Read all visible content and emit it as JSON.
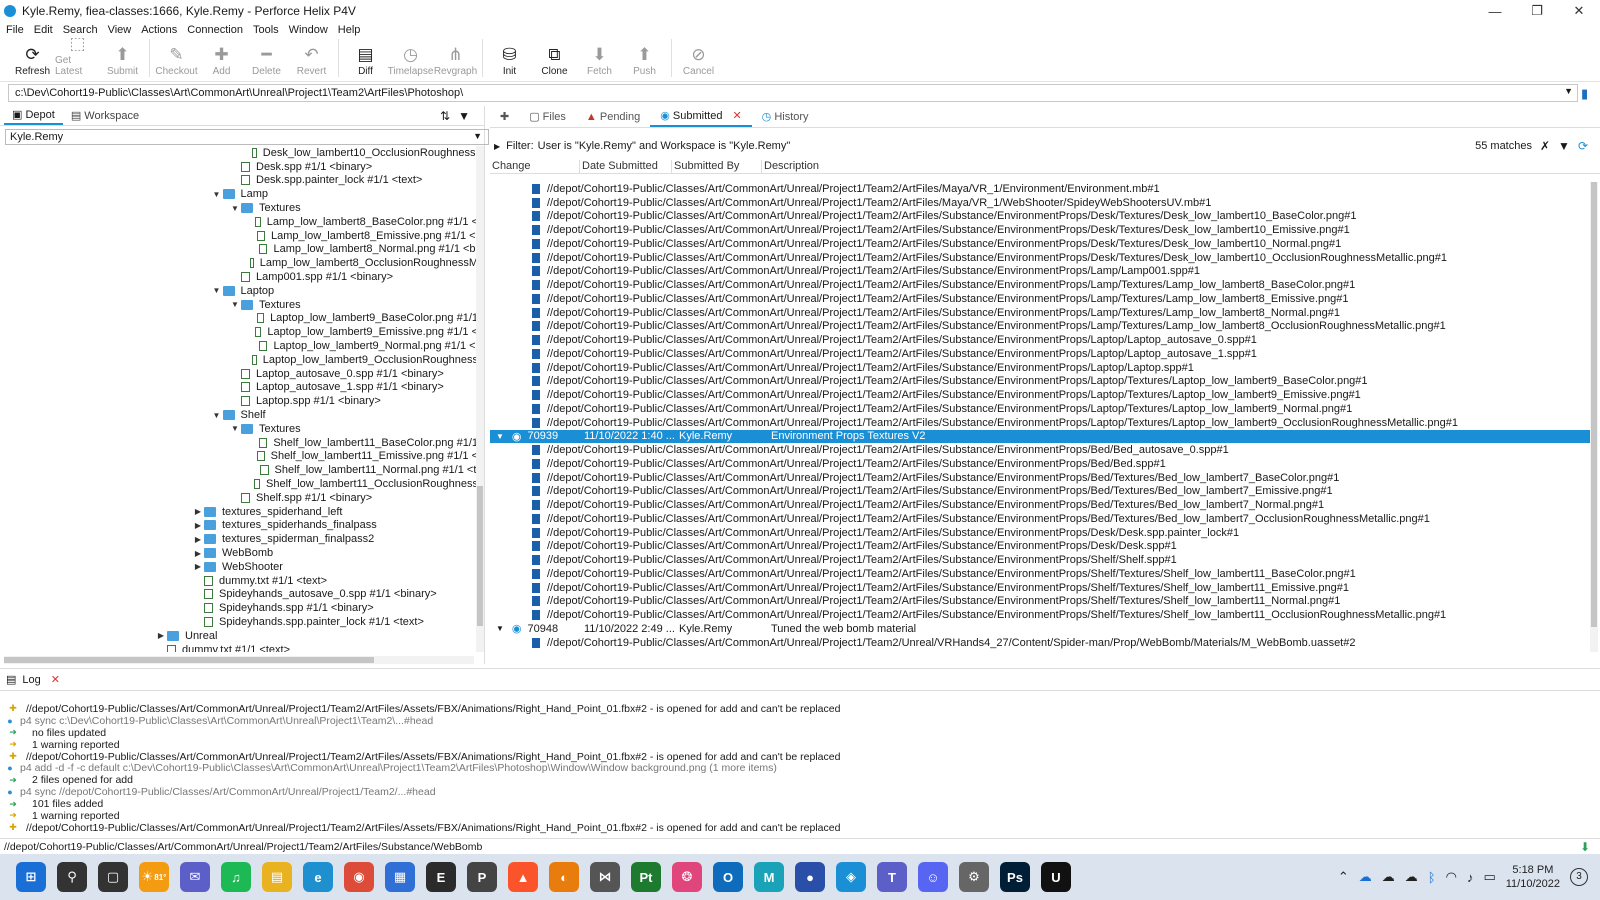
{
  "window": {
    "title": "Kyle.Remy,  fiea-classes:1666,  Kyle.Remy - Perforce Helix P4V"
  },
  "menu": [
    "File",
    "Edit",
    "Search",
    "View",
    "Actions",
    "Connection",
    "Tools",
    "Window",
    "Help"
  ],
  "toolbar": {
    "buttons": [
      {
        "label": "Refresh",
        "icon": "refresh-icon",
        "enabled": true
      },
      {
        "label": "Get Latest",
        "icon": "get-latest-icon",
        "enabled": false
      },
      {
        "label": "Submit",
        "icon": "submit-icon",
        "enabled": false
      },
      {
        "label": "Checkout",
        "icon": "checkout-icon",
        "enabled": false
      },
      {
        "label": "Add",
        "icon": "add-icon",
        "enabled": false
      },
      {
        "label": "Delete",
        "icon": "delete-icon",
        "enabled": false
      },
      {
        "label": "Revert",
        "icon": "revert-icon",
        "enabled": false
      },
      {
        "label": "Diff",
        "icon": "diff-icon",
        "enabled": true
      },
      {
        "label": "Timelapse",
        "icon": "timelapse-icon",
        "enabled": false
      },
      {
        "label": "Revgraph",
        "icon": "revgraph-icon",
        "enabled": false
      },
      {
        "label": "Init",
        "icon": "init-icon",
        "enabled": true
      },
      {
        "label": "Clone",
        "icon": "clone-icon",
        "enabled": true
      },
      {
        "label": "Fetch",
        "icon": "fetch-icon",
        "enabled": false
      },
      {
        "label": "Push",
        "icon": "push-icon",
        "enabled": false
      },
      {
        "label": "Cancel",
        "icon": "cancel-icon",
        "enabled": false
      }
    ]
  },
  "path_bar": {
    "value": "c:\\Dev\\Cohort19-Public\\Classes\\Art\\CommonArt\\Unreal\\Project1\\Team2\\ArtFiles\\Photoshop\\"
  },
  "left_pane": {
    "tabs": [
      "Depot",
      "Workspace"
    ],
    "workspace": "Kyle.Remy",
    "tree": [
      {
        "indent": 5,
        "twisty": "",
        "type": "file",
        "label": "Desk_low_lambert10_OcclusionRoughnessl"
      },
      {
        "indent": 4,
        "twisty": "",
        "type": "file",
        "label": "Desk.spp #1/1 <binary>"
      },
      {
        "indent": 4,
        "twisty": "",
        "type": "file",
        "label": "Desk.spp.painter_lock #1/1 <text>"
      },
      {
        "indent": 3,
        "twisty": "▼",
        "type": "folder",
        "label": "Lamp"
      },
      {
        "indent": 4,
        "twisty": "▼",
        "type": "folder",
        "label": "Textures"
      },
      {
        "indent": 5,
        "twisty": "",
        "type": "file",
        "label": "Lamp_low_lambert8_BaseColor.png #1/1 <"
      },
      {
        "indent": 5,
        "twisty": "",
        "type": "file",
        "label": "Lamp_low_lambert8_Emissive.png #1/1 <l"
      },
      {
        "indent": 5,
        "twisty": "",
        "type": "file",
        "label": "Lamp_low_lambert8_Normal.png #1/1 <bi"
      },
      {
        "indent": 5,
        "twisty": "",
        "type": "file",
        "label": "Lamp_low_lambert8_OcclusionRoughnessM"
      },
      {
        "indent": 4,
        "twisty": "",
        "type": "file",
        "label": "Lamp001.spp #1/1 <binary>"
      },
      {
        "indent": 3,
        "twisty": "▼",
        "type": "folder",
        "label": "Laptop"
      },
      {
        "indent": 4,
        "twisty": "▼",
        "type": "folder",
        "label": "Textures"
      },
      {
        "indent": 5,
        "twisty": "",
        "type": "file",
        "label": "Laptop_low_lambert9_BaseColor.png #1/1"
      },
      {
        "indent": 5,
        "twisty": "",
        "type": "file",
        "label": "Laptop_low_lambert9_Emissive.png #1/1 <"
      },
      {
        "indent": 5,
        "twisty": "",
        "type": "file",
        "label": "Laptop_low_lambert9_Normal.png #1/1 <l"
      },
      {
        "indent": 5,
        "twisty": "",
        "type": "file",
        "label": "Laptop_low_lambert9_OcclusionRoughness"
      },
      {
        "indent": 4,
        "twisty": "",
        "type": "file",
        "label": "Laptop_autosave_0.spp #1/1 <binary>"
      },
      {
        "indent": 4,
        "twisty": "",
        "type": "file",
        "label": "Laptop_autosave_1.spp #1/1 <binary>"
      },
      {
        "indent": 4,
        "twisty": "",
        "type": "file",
        "label": "Laptop.spp #1/1 <binary>"
      },
      {
        "indent": 3,
        "twisty": "▼",
        "type": "folder",
        "label": "Shelf"
      },
      {
        "indent": 4,
        "twisty": "▼",
        "type": "folder",
        "label": "Textures"
      },
      {
        "indent": 5,
        "twisty": "",
        "type": "file",
        "label": "Shelf_low_lambert11_BaseColor.png #1/1"
      },
      {
        "indent": 5,
        "twisty": "",
        "type": "file",
        "label": "Shelf_low_lambert11_Emissive.png #1/1 <"
      },
      {
        "indent": 5,
        "twisty": "",
        "type": "file",
        "label": "Shelf_low_lambert11_Normal.png #1/1 <t"
      },
      {
        "indent": 5,
        "twisty": "",
        "type": "file",
        "label": "Shelf_low_lambert11_OcclusionRoughness"
      },
      {
        "indent": 4,
        "twisty": "",
        "type": "file",
        "label": "Shelf.spp #1/1 <binary>"
      },
      {
        "indent": 2,
        "twisty": "▶",
        "type": "folder",
        "label": "textures_spiderhand_left"
      },
      {
        "indent": 2,
        "twisty": "▶",
        "type": "folder",
        "label": "textures_spiderhands_finalpass"
      },
      {
        "indent": 2,
        "twisty": "▶",
        "type": "folder",
        "label": "textures_spiderman_finalpass2"
      },
      {
        "indent": 2,
        "twisty": "▶",
        "type": "folder",
        "label": "WebBomb"
      },
      {
        "indent": 2,
        "twisty": "▶",
        "type": "folder",
        "label": "WebShooter"
      },
      {
        "indent": 2,
        "twisty": "",
        "type": "file",
        "label": "dummy.txt #1/1 <text>"
      },
      {
        "indent": 2,
        "twisty": "",
        "type": "file",
        "label": "Spideyhands_autosave_0.spp #1/1 <binary>"
      },
      {
        "indent": 2,
        "twisty": "",
        "type": "file",
        "label": "Spideyhands.spp #1/1 <binary>"
      },
      {
        "indent": 2,
        "twisty": "",
        "type": "file",
        "label": "Spideyhands.spp.painter_lock #1/1 <text>"
      },
      {
        "indent": 0,
        "twisty": "▶",
        "type": "folder",
        "label": "Unreal"
      },
      {
        "indent": 0,
        "twisty": "",
        "type": "file",
        "label": "dummy.txt #1/1 <text>"
      }
    ]
  },
  "right_pane": {
    "tabs": [
      "Files",
      "Pending",
      "Submitted",
      "History"
    ],
    "active_tab": "Submitted",
    "filter_label": "Filter:",
    "filter_text": "User is \"Kyle.Remy\" and Workspace is \"Kyle.Remy\"",
    "matches": "55 matches",
    "columns": [
      "Change",
      "Date Submitted",
      "Submitted By",
      "Description"
    ],
    "rows": [
      {
        "kind": "file",
        "text": "//depot/Cohort19-Public/Classes/Art/CommonArt/Unreal/Project1/Team2/ArtFiles/Maya/VR_1/Environment/Environment.mb#1"
      },
      {
        "kind": "file",
        "text": "//depot/Cohort19-Public/Classes/Art/CommonArt/Unreal/Project1/Team2/ArtFiles/Maya/VR_1/WebShooter/SpideyWebShootersUV.mb#1"
      },
      {
        "kind": "file",
        "text": "//depot/Cohort19-Public/Classes/Art/CommonArt/Unreal/Project1/Team2/ArtFiles/Substance/EnvironmentProps/Desk/Textures/Desk_low_lambert10_BaseColor.png#1"
      },
      {
        "kind": "file",
        "text": "//depot/Cohort19-Public/Classes/Art/CommonArt/Unreal/Project1/Team2/ArtFiles/Substance/EnvironmentProps/Desk/Textures/Desk_low_lambert10_Emissive.png#1"
      },
      {
        "kind": "file",
        "text": "//depot/Cohort19-Public/Classes/Art/CommonArt/Unreal/Project1/Team2/ArtFiles/Substance/EnvironmentProps/Desk/Textures/Desk_low_lambert10_Normal.png#1"
      },
      {
        "kind": "file",
        "text": "//depot/Cohort19-Public/Classes/Art/CommonArt/Unreal/Project1/Team2/ArtFiles/Substance/EnvironmentProps/Desk/Textures/Desk_low_lambert10_OcclusionRoughnessMetallic.png#1"
      },
      {
        "kind": "file",
        "text": "//depot/Cohort19-Public/Classes/Art/CommonArt/Unreal/Project1/Team2/ArtFiles/Substance/EnvironmentProps/Lamp/Lamp001.spp#1"
      },
      {
        "kind": "file",
        "text": "//depot/Cohort19-Public/Classes/Art/CommonArt/Unreal/Project1/Team2/ArtFiles/Substance/EnvironmentProps/Lamp/Textures/Lamp_low_lambert8_BaseColor.png#1"
      },
      {
        "kind": "file",
        "text": "//depot/Cohort19-Public/Classes/Art/CommonArt/Unreal/Project1/Team2/ArtFiles/Substance/EnvironmentProps/Lamp/Textures/Lamp_low_lambert8_Emissive.png#1"
      },
      {
        "kind": "file",
        "text": "//depot/Cohort19-Public/Classes/Art/CommonArt/Unreal/Project1/Team2/ArtFiles/Substance/EnvironmentProps/Lamp/Textures/Lamp_low_lambert8_Normal.png#1"
      },
      {
        "kind": "file",
        "text": "//depot/Cohort19-Public/Classes/Art/CommonArt/Unreal/Project1/Team2/ArtFiles/Substance/EnvironmentProps/Lamp/Textures/Lamp_low_lambert8_OcclusionRoughnessMetallic.png#1"
      },
      {
        "kind": "file",
        "text": "//depot/Cohort19-Public/Classes/Art/CommonArt/Unreal/Project1/Team2/ArtFiles/Substance/EnvironmentProps/Laptop/Laptop_autosave_0.spp#1"
      },
      {
        "kind": "file",
        "text": "//depot/Cohort19-Public/Classes/Art/CommonArt/Unreal/Project1/Team2/ArtFiles/Substance/EnvironmentProps/Laptop/Laptop_autosave_1.spp#1"
      },
      {
        "kind": "file",
        "text": "//depot/Cohort19-Public/Classes/Art/CommonArt/Unreal/Project1/Team2/ArtFiles/Substance/EnvironmentProps/Laptop/Laptop.spp#1"
      },
      {
        "kind": "file",
        "text": "//depot/Cohort19-Public/Classes/Art/CommonArt/Unreal/Project1/Team2/ArtFiles/Substance/EnvironmentProps/Laptop/Textures/Laptop_low_lambert9_BaseColor.png#1"
      },
      {
        "kind": "file",
        "text": "//depot/Cohort19-Public/Classes/Art/CommonArt/Unreal/Project1/Team2/ArtFiles/Substance/EnvironmentProps/Laptop/Textures/Laptop_low_lambert9_Emissive.png#1"
      },
      {
        "kind": "file",
        "text": "//depot/Cohort19-Public/Classes/Art/CommonArt/Unreal/Project1/Team2/ArtFiles/Substance/EnvironmentProps/Laptop/Textures/Laptop_low_lambert9_Normal.png#1"
      },
      {
        "kind": "file",
        "text": "//depot/Cohort19-Public/Classes/Art/CommonArt/Unreal/Project1/Team2/ArtFiles/Substance/EnvironmentProps/Laptop/Textures/Laptop_low_lambert9_OcclusionRoughnessMetallic.png#1"
      },
      {
        "kind": "change",
        "selected": true,
        "change": "70939",
        "date": "11/10/2022 1:40 ...",
        "by": "Kyle.Remy",
        "desc": "Environment Props Textures V2"
      },
      {
        "kind": "file",
        "text": "//depot/Cohort19-Public/Classes/Art/CommonArt/Unreal/Project1/Team2/ArtFiles/Substance/EnvironmentProps/Bed/Bed_autosave_0.spp#1"
      },
      {
        "kind": "file",
        "text": "//depot/Cohort19-Public/Classes/Art/CommonArt/Unreal/Project1/Team2/ArtFiles/Substance/EnvironmentProps/Bed/Bed.spp#1"
      },
      {
        "kind": "file",
        "text": "//depot/Cohort19-Public/Classes/Art/CommonArt/Unreal/Project1/Team2/ArtFiles/Substance/EnvironmentProps/Bed/Textures/Bed_low_lambert7_BaseColor.png#1"
      },
      {
        "kind": "file",
        "text": "//depot/Cohort19-Public/Classes/Art/CommonArt/Unreal/Project1/Team2/ArtFiles/Substance/EnvironmentProps/Bed/Textures/Bed_low_lambert7_Emissive.png#1"
      },
      {
        "kind": "file",
        "text": "//depot/Cohort19-Public/Classes/Art/CommonArt/Unreal/Project1/Team2/ArtFiles/Substance/EnvironmentProps/Bed/Textures/Bed_low_lambert7_Normal.png#1"
      },
      {
        "kind": "file",
        "text": "//depot/Cohort19-Public/Classes/Art/CommonArt/Unreal/Project1/Team2/ArtFiles/Substance/EnvironmentProps/Bed/Textures/Bed_low_lambert7_OcclusionRoughnessMetallic.png#1"
      },
      {
        "kind": "file",
        "text": "//depot/Cohort19-Public/Classes/Art/CommonArt/Unreal/Project1/Team2/ArtFiles/Substance/EnvironmentProps/Desk/Desk.spp.painter_lock#1"
      },
      {
        "kind": "file",
        "text": "//depot/Cohort19-Public/Classes/Art/CommonArt/Unreal/Project1/Team2/ArtFiles/Substance/EnvironmentProps/Desk/Desk.spp#1"
      },
      {
        "kind": "file",
        "text": "//depot/Cohort19-Public/Classes/Art/CommonArt/Unreal/Project1/Team2/ArtFiles/Substance/EnvironmentProps/Shelf/Shelf.spp#1"
      },
      {
        "kind": "file",
        "text": "//depot/Cohort19-Public/Classes/Art/CommonArt/Unreal/Project1/Team2/ArtFiles/Substance/EnvironmentProps/Shelf/Textures/Shelf_low_lambert11_BaseColor.png#1"
      },
      {
        "kind": "file",
        "text": "//depot/Cohort19-Public/Classes/Art/CommonArt/Unreal/Project1/Team2/ArtFiles/Substance/EnvironmentProps/Shelf/Textures/Shelf_low_lambert11_Emissive.png#1"
      },
      {
        "kind": "file",
        "text": "//depot/Cohort19-Public/Classes/Art/CommonArt/Unreal/Project1/Team2/ArtFiles/Substance/EnvironmentProps/Shelf/Textures/Shelf_low_lambert11_Normal.png#1"
      },
      {
        "kind": "file",
        "text": "//depot/Cohort19-Public/Classes/Art/CommonArt/Unreal/Project1/Team2/ArtFiles/Substance/EnvironmentProps/Shelf/Textures/Shelf_low_lambert11_OcclusionRoughnessMetallic.png#1"
      },
      {
        "kind": "change",
        "selected": false,
        "change": "70948",
        "date": "11/10/2022 2:49 ...",
        "by": "Kyle.Remy",
        "desc": "Tuned the web bomb material"
      },
      {
        "kind": "file",
        "text": "//depot/Cohort19-Public/Classes/Art/CommonArt/Unreal/Project1/Team2/Unreal/VRHands4_27/Content/Spider-man/Prop/WebBomb/Materials/M_WebBomb.uasset#2"
      }
    ]
  },
  "log": {
    "tab": "Log",
    "lines": [
      {
        "kind": "warn",
        "text": "//depot/Cohort19-Public/Classes/Art/CommonArt/Unreal/Project1/Team2/ArtFiles/Assets/FBX/Animations/Right_Hand_Point_01.fbx#2 - is opened for add and can't be replaced"
      },
      {
        "kind": "cmd",
        "text": "p4 sync c:\\Dev\\Cohort19-Public\\Classes\\Art\\CommonArt\\Unreal\\Project1\\Team2\\...#head"
      },
      {
        "kind": "ok",
        "text": "no files updated"
      },
      {
        "kind": "ok2",
        "text": "1 warning reported"
      },
      {
        "kind": "warn",
        "text": "//depot/Cohort19-Public/Classes/Art/CommonArt/Unreal/Project1/Team2/ArtFiles/Assets/FBX/Animations/Right_Hand_Point_01.fbx#2 - is opened for add and can't be replaced"
      },
      {
        "kind": "cmd",
        "text": "p4 add -d -f -c default c:\\Dev\\Cohort19-Public\\Classes\\Art\\CommonArt\\Unreal\\Project1\\Team2\\ArtFiles\\Photoshop\\Window\\Window background.png (1 more items)"
      },
      {
        "kind": "ok",
        "text": "2 files opened for add"
      },
      {
        "kind": "cmd",
        "text": "p4 sync //depot/Cohort19-Public/Classes/Art/CommonArt/Unreal/Project1/Team2/...#head"
      },
      {
        "kind": "ok",
        "text": "101 files added"
      },
      {
        "kind": "ok2",
        "text": "1 warning reported"
      },
      {
        "kind": "warn",
        "text": "//depot/Cohort19-Public/Classes/Art/CommonArt/Unreal/Project1/Team2/ArtFiles/Assets/FBX/Animations/Right_Hand_Point_01.fbx#2 - is opened for add and can't be replaced"
      }
    ]
  },
  "status_bar": {
    "text": "//depot/Cohort19-Public/Classes/Art/CommonArt/Unreal/Project1/Team2/ArtFiles/Substance/WebBomb"
  },
  "taskbar": {
    "weather": "81°",
    "apps": [
      {
        "name": "start-icon",
        "glyph": "⊞",
        "color": "#1a6fd6"
      },
      {
        "name": "search-icon",
        "glyph": "⚲",
        "color": "#333333"
      },
      {
        "name": "task-view-icon",
        "glyph": "▢",
        "color": "#333333"
      },
      {
        "name": "weather-icon",
        "glyph": "☀",
        "color": "#f39c12"
      },
      {
        "name": "chat-icon",
        "glyph": "✉",
        "color": "#5b5fc7"
      },
      {
        "name": "spotify-icon",
        "glyph": "♫",
        "color": "#1db954"
      },
      {
        "name": "file-explorer-icon",
        "glyph": "▤",
        "color": "#e8b220"
      },
      {
        "name": "edge-icon",
        "glyph": "e",
        "color": "#1e8fcf"
      },
      {
        "name": "chrome-icon",
        "glyph": "◉",
        "color": "#dd4b39"
      },
      {
        "name": "store-icon",
        "glyph": "▦",
        "color": "#2f6fd6"
      },
      {
        "name": "epic-games-icon",
        "glyph": "E",
        "color": "#2b2b2b"
      },
      {
        "name": "perforce-search-icon",
        "glyph": "P",
        "color": "#444444"
      },
      {
        "name": "brave-icon",
        "glyph": "▲",
        "color": "#fb542b"
      },
      {
        "name": "blender-icon",
        "glyph": "◐",
        "color": "#e87d0d"
      },
      {
        "name": "maya-icon",
        "glyph": "⋈",
        "color": "#555555"
      },
      {
        "name": "pycharm-icon",
        "glyph": "Pt",
        "color": "#1d7a2e"
      },
      {
        "name": "photos-icon",
        "glyph": "❂",
        "color": "#e0457b"
      },
      {
        "name": "outlook-icon",
        "glyph": "O",
        "color": "#0f6cbd"
      },
      {
        "name": "maya-m-icon",
        "glyph": "M",
        "color": "#1aa3b8"
      },
      {
        "name": "bluetooth-app-icon",
        "glyph": "●",
        "color": "#2a4fa8"
      },
      {
        "name": "p4v-icon",
        "glyph": "◈",
        "color": "#1a8fd6"
      },
      {
        "name": "teams-icon",
        "glyph": "T",
        "color": "#5b5fc7"
      },
      {
        "name": "discord-icon",
        "glyph": "☺",
        "color": "#5865f2"
      },
      {
        "name": "settings-icon",
        "glyph": "⚙",
        "color": "#666666"
      },
      {
        "name": "photoshop-icon",
        "glyph": "Ps",
        "color": "#001e36"
      },
      {
        "name": "unreal-icon",
        "glyph": "U",
        "color": "#111111"
      }
    ],
    "time": "5:18 PM",
    "date": "11/10/2022",
    "notifications": "3"
  }
}
